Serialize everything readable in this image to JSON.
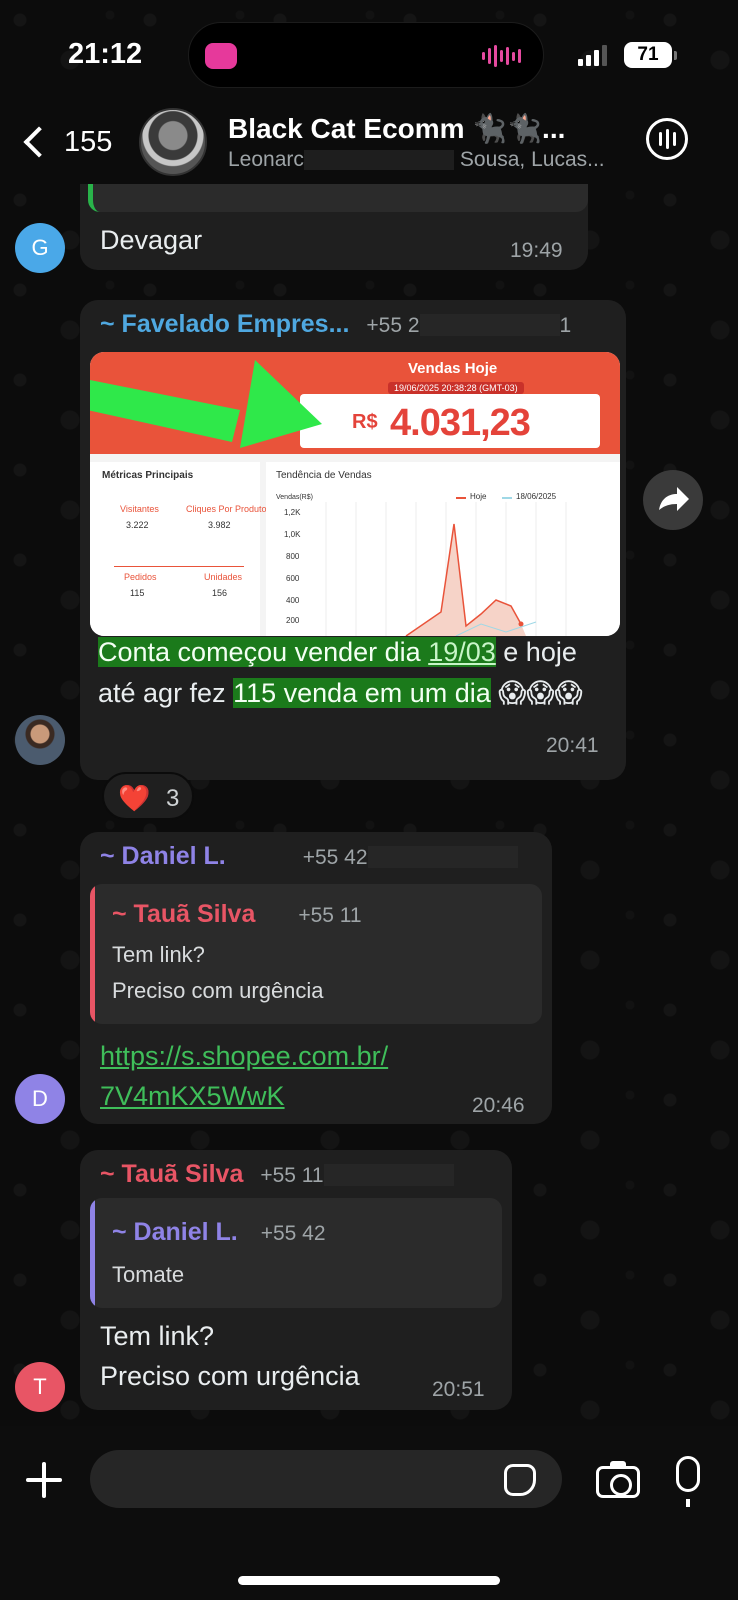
{
  "status_bar": {
    "time": "21:12",
    "battery": "71"
  },
  "header": {
    "back_count": "155",
    "title": "Black Cat Ecomm 🐈‍⬛🐈‍⬛...",
    "members_start": "Leonarc",
    "members_end": "Sousa, Lucas..."
  },
  "messages": [
    {
      "text": "Devagar",
      "time": "19:49",
      "avatar_letter": "G"
    },
    {
      "sender": "~ Favelado Empres...",
      "phone": "+55 2",
      "phone_end": "1",
      "image": {
        "title": "Vendas Hoje",
        "date": "19/06/2025 20:38:28 (GMT-03)",
        "currency": "R$",
        "value": "4.031,23",
        "metrics_title": "Métricas Principais",
        "metrics": [
          {
            "label": "Visitantes",
            "value": "3.222"
          },
          {
            "label": "Cliques Por Produto",
            "value": "3.982"
          },
          {
            "label": "Pedidos",
            "value": "115"
          },
          {
            "label": "Unidades",
            "value": "156"
          }
        ],
        "trend_title": "Tendência de Vendas",
        "trend_ylabel": "Vendas(R$)",
        "trend_ticks": [
          "1,2K",
          "1,0K",
          "800",
          "600",
          "400",
          "200"
        ],
        "legend": [
          "Hoje",
          "18/06/2025"
        ]
      },
      "text_parts": [
        "Conta começou vender dia ",
        "19/03",
        " e hoje até agr fez ",
        "115 venda em um dia",
        " 😱😱😱"
      ],
      "time": "20:41",
      "reaction": {
        "emoji": "❤️",
        "count": "3"
      }
    },
    {
      "sender": "~ Daniel L.",
      "phone": "+55 42",
      "quote": {
        "sender": "~ Tauã Silva",
        "phone": "+55 11",
        "line1": "Tem link?",
        "line2": "Preciso com urgência"
      },
      "link_line1": "https://s.shopee.com.br/",
      "link_line2": "7V4mKX5WwK",
      "time": "20:46",
      "avatar_letter": "D"
    },
    {
      "sender": "~ Tauã Silva",
      "phone": "+55 11",
      "quote": {
        "sender": "~ Daniel L.",
        "phone": "+55 42",
        "line1": "Tomate"
      },
      "line1": "Tem link?",
      "line2": "Preciso com urgência",
      "time": "20:51",
      "avatar_letter": "T"
    }
  ],
  "colors": {
    "favelado": "#4fa8e0",
    "daniel": "#8f83e6",
    "taua": "#e85565",
    "highlight": "#1b7a1b",
    "link": "#3fbe5a"
  }
}
